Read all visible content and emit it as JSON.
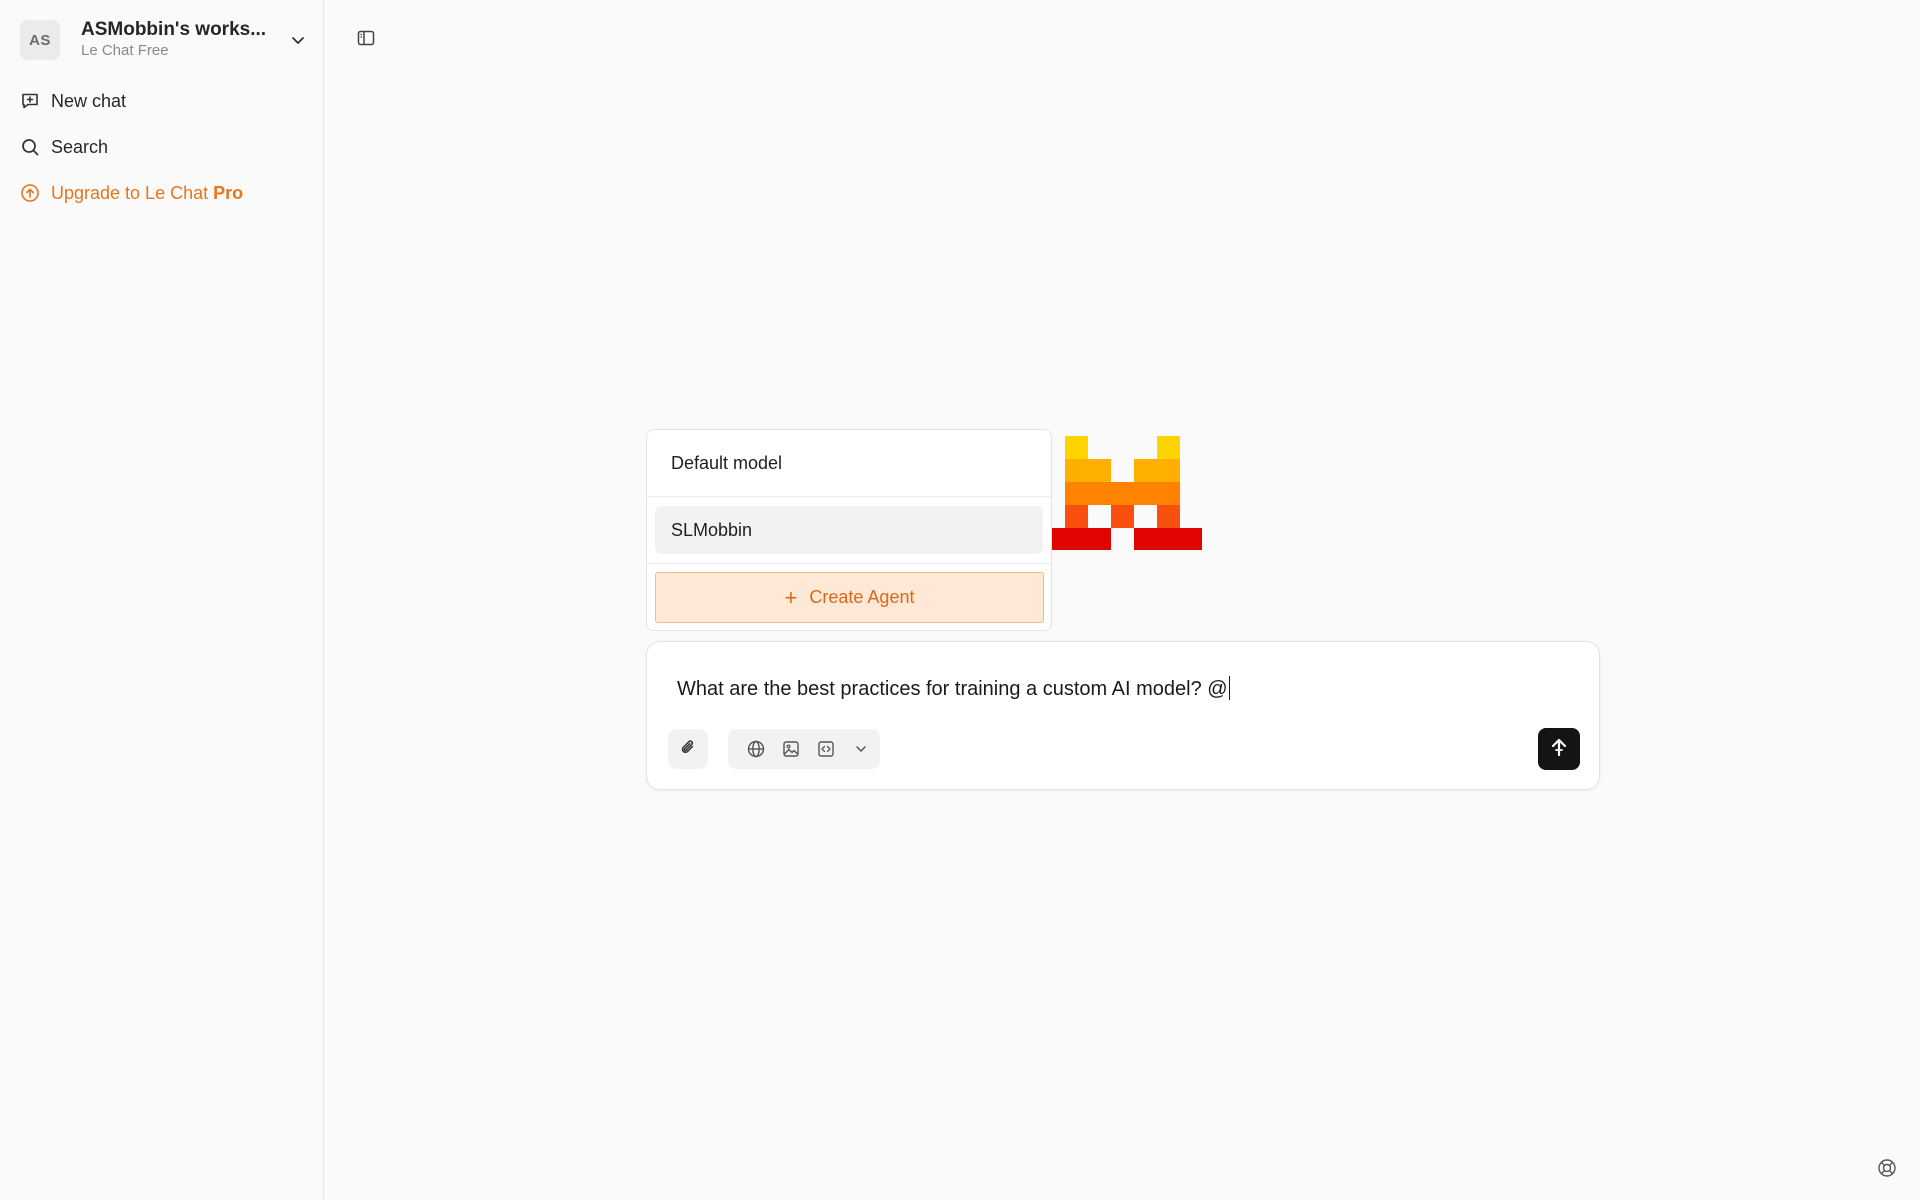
{
  "workspace": {
    "initials": "AS",
    "name": "ASMobbin's works...",
    "plan": "Le Chat Free"
  },
  "sidebar": {
    "items": [
      {
        "label": "New chat",
        "icon": "new-chat-icon"
      },
      {
        "label": "Search",
        "icon": "search-icon"
      }
    ],
    "upgrade": {
      "prefix": "Upgrade to Le Chat ",
      "emphasis": "Pro",
      "icon": "upgrade-arrow-icon"
    }
  },
  "agent_menu": {
    "header": "Default model",
    "items": [
      "SLMobbin"
    ],
    "create_label": "Create Agent"
  },
  "composer": {
    "text": "What are the best practices for training a custom AI model? @",
    "tools": [
      "globe-icon",
      "image-icon",
      "code-icon",
      "chevron-down-icon"
    ]
  },
  "colors": {
    "accent": "#e8751a",
    "create_bg": "#ffe8d6",
    "send_bg": "#141414",
    "logo": [
      "#ffd400",
      "#ffaf00",
      "#ff8200",
      "#fa500f",
      "#e10500"
    ]
  }
}
